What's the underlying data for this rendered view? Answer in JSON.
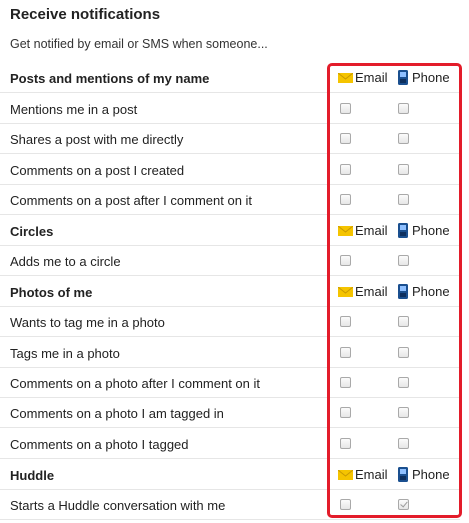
{
  "title": "Receive notifications",
  "subtitle": "Get notified by email or SMS when someone...",
  "columns": {
    "email": "Email",
    "phone": "Phone"
  },
  "sections": [
    {
      "label": "Posts and mentions of my name"
    },
    {
      "label": "Circles"
    },
    {
      "label": "Photos of me"
    },
    {
      "label": "Huddle"
    }
  ],
  "items": [
    {
      "label": "Mentions me in a post",
      "email": false,
      "phone": false
    },
    {
      "label": "Shares a post with me directly",
      "email": false,
      "phone": false
    },
    {
      "label": "Comments on a post I created",
      "email": false,
      "phone": false
    },
    {
      "label": "Comments on a post after I comment on it",
      "email": false,
      "phone": false
    },
    {
      "label": "Adds me to a circle",
      "email": false,
      "phone": false
    },
    {
      "label": "Wants to tag me in a photo",
      "email": false,
      "phone": false
    },
    {
      "label": "Tags me in a photo",
      "email": false,
      "phone": false
    },
    {
      "label": "Comments on a photo after I comment on it",
      "email": false,
      "phone": false
    },
    {
      "label": "Comments on a photo I am tagged in",
      "email": false,
      "phone": false
    },
    {
      "label": "Comments on a photo I tagged",
      "email": false,
      "phone": false
    },
    {
      "label": "Starts a Huddle conversation with me",
      "email": false,
      "phone": true
    }
  ],
  "colors": {
    "highlight": "#e31c2a",
    "email_icon": "#f5c400",
    "phone_icon": "#1a4f8f"
  }
}
